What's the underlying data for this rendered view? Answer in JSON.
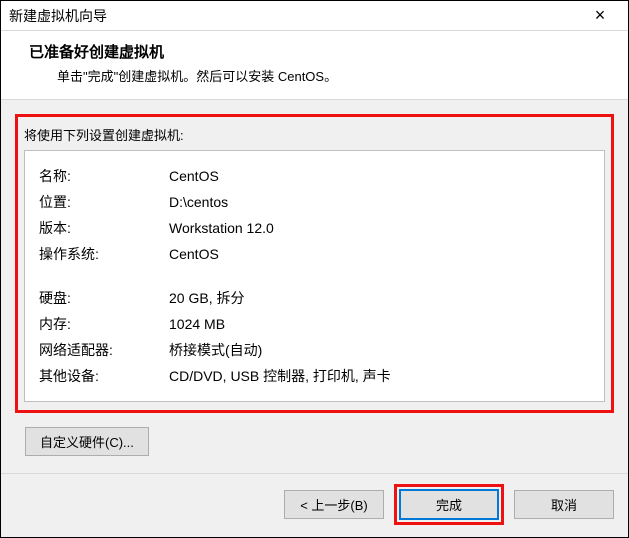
{
  "window": {
    "title": "新建虚拟机向导",
    "close_glyph": "×"
  },
  "header": {
    "heading": "已准备好创建虚拟机",
    "subheading": "单击\"完成\"创建虚拟机。然后可以安装 CentOS。"
  },
  "summary": {
    "caption": "将使用下列设置创建虚拟机:",
    "rows_top": [
      {
        "label": "名称:",
        "value": "CentOS"
      },
      {
        "label": "位置:",
        "value": "D:\\centos"
      },
      {
        "label": "版本:",
        "value": "Workstation 12.0"
      },
      {
        "label": "操作系统:",
        "value": "CentOS"
      }
    ],
    "rows_bottom": [
      {
        "label": "硬盘:",
        "value": "20 GB, 拆分"
      },
      {
        "label": "内存:",
        "value": "1024 MB"
      },
      {
        "label": "网络适配器:",
        "value": "桥接模式(自动)"
      },
      {
        "label": "其他设备:",
        "value": "CD/DVD, USB 控制器, 打印机, 声卡"
      }
    ]
  },
  "buttons": {
    "customize": "自定义硬件(C)...",
    "back": "< 上一步(B)",
    "finish": "完成",
    "cancel": "取消"
  }
}
